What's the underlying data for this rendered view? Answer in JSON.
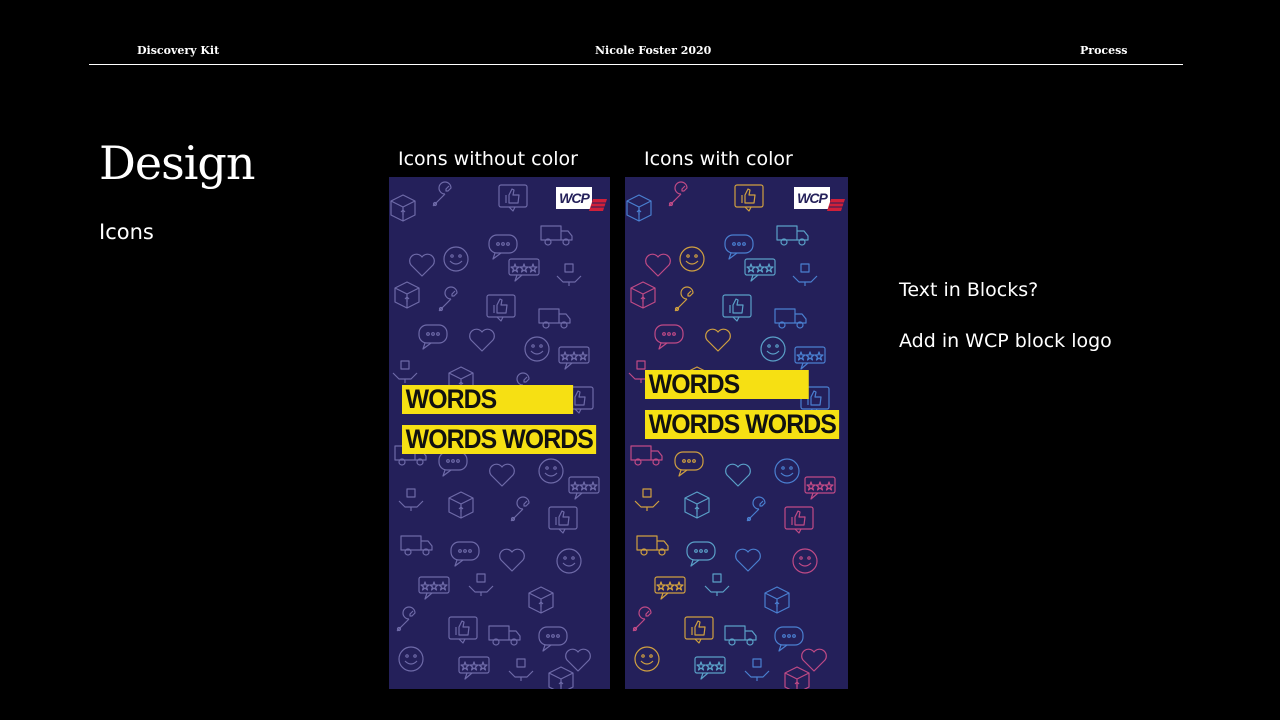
{
  "header": {
    "left": "Discovery Kit",
    "center": "Nicole Foster 2020",
    "right": "Process"
  },
  "title": "Design",
  "subtitle": "Icons",
  "panels": [
    {
      "caption": "Icons without color",
      "logo_text": "WCP",
      "block_line1": "WORDS",
      "block_line2": "WORDS WORDS",
      "icon_style": "monochrome"
    },
    {
      "caption": "Icons with color",
      "logo_text": "WCP",
      "block_line1": "WORDS",
      "block_line2": "WORDS WORDS",
      "icon_style": "colored"
    }
  ],
  "notes": {
    "line1": "Text in Blocks?",
    "line2": "Add in WCP block logo"
  },
  "colors": {
    "background": "#000000",
    "panel": "#24205a",
    "highlight": "#f6e013",
    "icon_mono": "#6e6aa8",
    "icon_colors": [
      "#4a7fd0",
      "#c04a86",
      "#d0a040",
      "#5aa0c8"
    ],
    "logo_accent": "#d0203a"
  },
  "icons": [
    "box-icon",
    "wrench-icon",
    "thumbs-up-icon",
    "truck-icon",
    "chat-bubble-icon",
    "heart-icon",
    "smiley-icon",
    "rating-stars-icon",
    "hand-holding-box-icon"
  ]
}
